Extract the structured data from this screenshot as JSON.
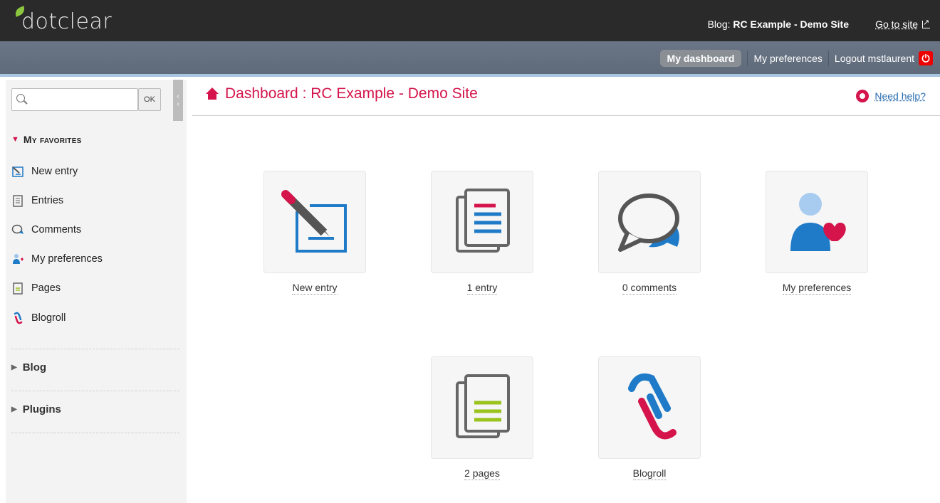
{
  "header": {
    "logo_text": "dotclear",
    "blog_prefix": "Blog:",
    "blog_name": "RC Example - Demo Site",
    "go_to_site": "Go to site"
  },
  "nav": {
    "dashboard": "My dashboard",
    "preferences": "My preferences",
    "logout": "Logout mstlaurent"
  },
  "sidebar": {
    "search_button": "OK",
    "search_placeholder": "",
    "favorites_title": "My favorites",
    "favorites": [
      {
        "label": "New entry",
        "icon": "new-entry-icon"
      },
      {
        "label": "Entries",
        "icon": "entries-icon"
      },
      {
        "label": "Comments",
        "icon": "comments-icon"
      },
      {
        "label": "My preferences",
        "icon": "preferences-icon"
      },
      {
        "label": "Pages",
        "icon": "pages-icon"
      },
      {
        "label": "Blogroll",
        "icon": "blogroll-icon"
      }
    ],
    "sections": [
      "Blog",
      "Plugins"
    ]
  },
  "main": {
    "title": "Dashboard : RC Example - Demo Site",
    "help": "Need help?",
    "tiles": [
      {
        "label": "New entry",
        "icon": "new-entry-icon"
      },
      {
        "label": "1 entry",
        "icon": "entries-icon"
      },
      {
        "label": "0 comments",
        "icon": "comments-icon"
      },
      {
        "label": "My preferences",
        "icon": "preferences-icon"
      },
      {
        "label": "2 pages",
        "icon": "pages-icon"
      },
      {
        "label": "Blogroll",
        "icon": "blogroll-icon"
      }
    ]
  },
  "colors": {
    "accent": "#d4144a",
    "link": "#2a6db0",
    "header_bg": "#2a2a2a",
    "nav_bg": "#5f6a7a",
    "logo_leaf": "#8cc63f",
    "icon_blue": "#1f7bc8",
    "icon_green": "#9ac31c"
  }
}
